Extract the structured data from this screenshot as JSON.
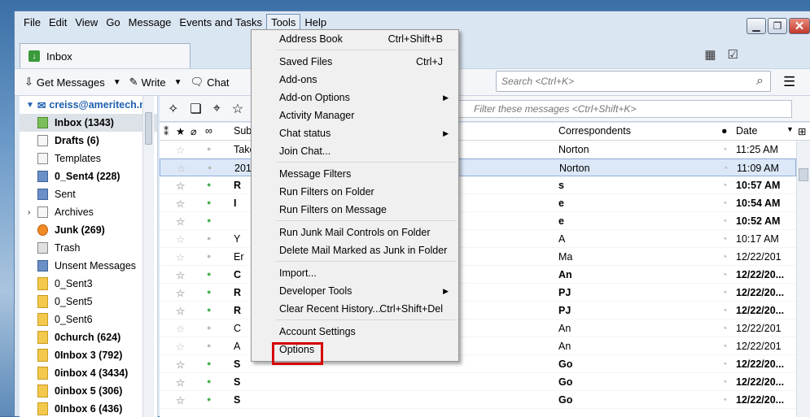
{
  "menubar": [
    "File",
    "Edit",
    "View",
    "Go",
    "Message",
    "Events and Tasks",
    "Tools",
    "Help"
  ],
  "tab": {
    "label": "Inbox"
  },
  "toolbar": {
    "get_messages": "Get Messages",
    "write": "Write",
    "chat": "Chat"
  },
  "search": {
    "placeholder": "Search <Ctrl+K>"
  },
  "filter": {
    "placeholder": "Filter these messages <Ctrl+Shift+K>"
  },
  "account": "creiss@ameritech.ne",
  "folders": [
    {
      "name": "Inbox (1343)",
      "icon": "inbox",
      "bold": true,
      "sel": true
    },
    {
      "name": "Drafts (6)",
      "icon": "doc",
      "bold": true
    },
    {
      "name": "Templates",
      "icon": "doc"
    },
    {
      "name": "0_Sent4 (228)",
      "icon": "blue",
      "bold": true
    },
    {
      "name": "Sent",
      "icon": "blue"
    },
    {
      "name": "Archives",
      "icon": "doc",
      "twisty": true
    },
    {
      "name": "Junk (269)",
      "icon": "junk",
      "bold": true
    },
    {
      "name": "Trash",
      "icon": "trash"
    },
    {
      "name": "Unsent Messages",
      "icon": "blue"
    },
    {
      "name": "0_Sent3",
      "icon": "folder"
    },
    {
      "name": "0_Sent5",
      "icon": "folder"
    },
    {
      "name": "0_Sent6",
      "icon": "folder"
    },
    {
      "name": "0church (624)",
      "icon": "folder",
      "bold": true
    },
    {
      "name": "0Inbox 3 (792)",
      "icon": "folder",
      "bold": true
    },
    {
      "name": "0inbox 4 (3434)",
      "icon": "folder",
      "bold": true
    },
    {
      "name": "0inbox 5 (306)",
      "icon": "folder",
      "bold": true
    },
    {
      "name": "0Inbox 6 (436)",
      "icon": "folder",
      "bold": true
    }
  ],
  "columns": {
    "subject": "Subj",
    "correspondents": "Correspondents",
    "date": "Date"
  },
  "messages": [
    {
      "subj": "Take",
      "corr": "Norton",
      "date": "11:25 AM",
      "bold": false,
      "dot": "grey"
    },
    {
      "subj": "2019",
      "corr": "Norton",
      "date": "11:09 AM",
      "bold": false,
      "dot": "grey",
      "sel": true
    },
    {
      "subj": "R",
      "corr": "s",
      "date": "10:57 AM",
      "bold": true,
      "dot": "green"
    },
    {
      "subj": "I",
      "corr": "e",
      "date": "10:54 AM",
      "bold": true,
      "dot": "green"
    },
    {
      "subj": "",
      "corr": "e",
      "date": "10:52 AM",
      "bold": true,
      "dot": "green"
    },
    {
      "subj": "Y",
      "corr": "A",
      "date": "10:17 AM",
      "bold": false,
      "dot": "grey"
    },
    {
      "subj": "Er",
      "corr": "Ma",
      "date": "12/22/201",
      "bold": false,
      "dot": "grey"
    },
    {
      "subj": "C",
      "corr": "An",
      "date": "12/22/20...",
      "bold": true,
      "dot": "green"
    },
    {
      "subj": "R",
      "corr": "PJ",
      "date": "12/22/20...",
      "bold": true,
      "dot": "green"
    },
    {
      "subj": "R",
      "corr": "PJ",
      "date": "12/22/20...",
      "bold": true,
      "dot": "green"
    },
    {
      "subj": "C",
      "corr": "An",
      "date": "12/22/201",
      "bold": false,
      "dot": "grey"
    },
    {
      "subj": "A",
      "corr": "An",
      "date": "12/22/201",
      "bold": false,
      "dot": "grey"
    },
    {
      "subj": "S",
      "corr": "Go",
      "date": "12/22/20...",
      "bold": true,
      "dot": "green"
    },
    {
      "subj": "S",
      "corr": "Go",
      "date": "12/22/20...",
      "bold": true,
      "dot": "green"
    },
    {
      "subj": "S",
      "corr": "Go",
      "date": "12/22/20...",
      "bold": true,
      "dot": "green"
    }
  ],
  "tools_menu": [
    {
      "label": "Address Book",
      "shortcut": "Ctrl+Shift+B"
    },
    {
      "sep": true
    },
    {
      "label": "Saved Files",
      "shortcut": "Ctrl+J"
    },
    {
      "label": "Add-ons"
    },
    {
      "label": "Add-on Options",
      "arrow": true
    },
    {
      "label": "Activity Manager"
    },
    {
      "label": "Chat status",
      "arrow": true
    },
    {
      "label": "Join Chat..."
    },
    {
      "sep": true
    },
    {
      "label": "Message Filters"
    },
    {
      "label": "Run Filters on Folder"
    },
    {
      "label": "Run Filters on Message"
    },
    {
      "sep": true
    },
    {
      "label": "Run Junk Mail Controls on Folder"
    },
    {
      "label": "Delete Mail Marked as Junk in Folder"
    },
    {
      "sep": true
    },
    {
      "label": "Import..."
    },
    {
      "label": "Developer Tools",
      "arrow": true
    },
    {
      "label": "Clear Recent History...",
      "shortcut": "Ctrl+Shift+Del"
    },
    {
      "sep": true
    },
    {
      "label": "Account Settings"
    },
    {
      "label": "Options"
    }
  ]
}
